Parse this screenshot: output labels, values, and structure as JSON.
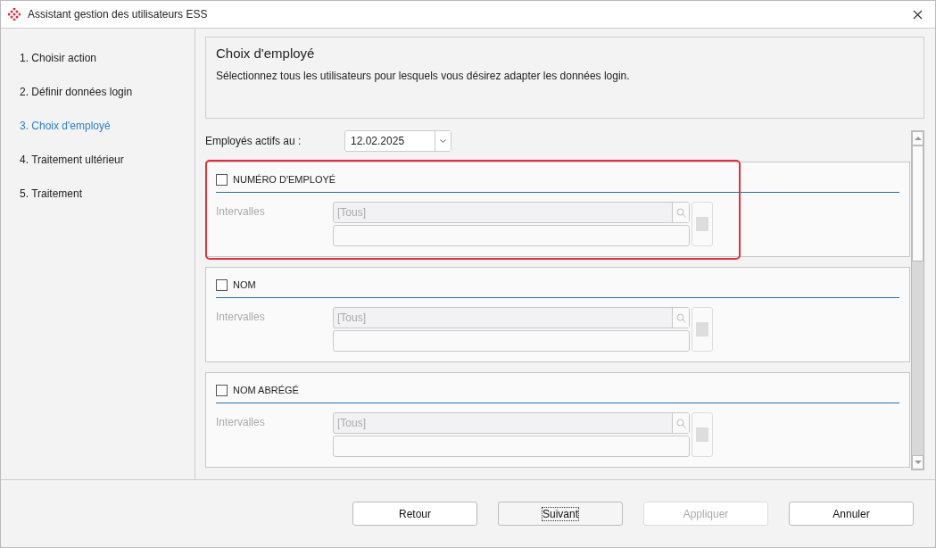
{
  "window": {
    "title": "Assistant gestion des utilisateurs ESS"
  },
  "steps": [
    {
      "label": "1. Choisir action",
      "selected": false
    },
    {
      "label": "2. Définir données login",
      "selected": false
    },
    {
      "label": "3. Choix d'employé",
      "selected": true
    },
    {
      "label": "4. Traitement ultérieur",
      "selected": false
    },
    {
      "label": "5. Traitement",
      "selected": false
    }
  ],
  "header": {
    "title": "Choix d'employé",
    "description": "Sélectionnez tous les utilisateurs pour lesquels vous désirez adapter les données login."
  },
  "date_filter": {
    "label": "Employés actifs au :",
    "value": "12.02.2025"
  },
  "sections": [
    {
      "title": "NUMÉRO D'EMPLOYÉ",
      "checked": false,
      "highlighted": true,
      "range_label": "Intervalles",
      "range_placeholder": "[Tous]"
    },
    {
      "title": "NOM",
      "checked": false,
      "highlighted": false,
      "range_label": "Intervalles",
      "range_placeholder": "[Tous]"
    },
    {
      "title": "NOM ABRÉGÉ",
      "checked": false,
      "highlighted": false,
      "range_label": "Intervalles",
      "range_placeholder": "[Tous]"
    }
  ],
  "buttons": [
    {
      "label": "Retour",
      "disabled": false,
      "focused": false
    },
    {
      "label": "Suivant",
      "disabled": false,
      "focused": true
    },
    {
      "label": "Appliquer",
      "disabled": true,
      "focused": false
    },
    {
      "label": "Annuler",
      "disabled": false,
      "focused": false
    }
  ]
}
